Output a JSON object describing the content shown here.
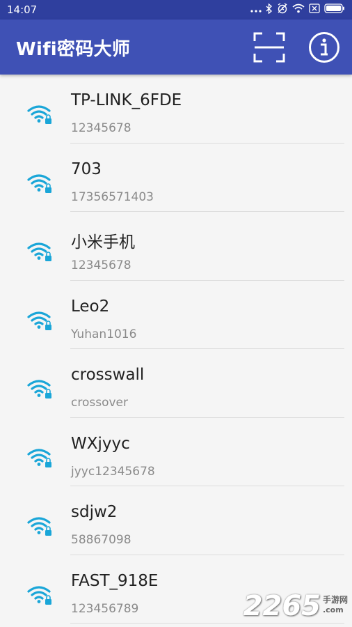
{
  "status_bar": {
    "time": "14:07",
    "icons": [
      "more-dots-icon",
      "bluetooth-icon",
      "alarm-icon",
      "wifi-status-icon",
      "sim-icon",
      "battery-icon"
    ]
  },
  "app_bar": {
    "title": "Wifi密码大师",
    "actions": [
      "scan-icon",
      "info-icon"
    ]
  },
  "networks": [
    {
      "ssid": "TP-LINK_6FDE",
      "password": "12345678"
    },
    {
      "ssid": "703",
      "password": "17356571403"
    },
    {
      "ssid": "小米手机",
      "password": "12345678"
    },
    {
      "ssid": "Leo2",
      "password": "Yuhan1016"
    },
    {
      "ssid": "crosswall",
      "password": "crossover"
    },
    {
      "ssid": "WXjyyc",
      "password": "jyyc12345678"
    },
    {
      "ssid": "sdjw2",
      "password": "58867098"
    },
    {
      "ssid": "FAST_918E",
      "password": "123456789"
    }
  ],
  "watermark": {
    "number": "2265",
    "suffix": "手游网",
    "suffix_url": ".com"
  },
  "colors": {
    "primary": "#3f51b5",
    "status_bar": "#2f3f9e",
    "wifi_icon": "#1aa6d8"
  }
}
